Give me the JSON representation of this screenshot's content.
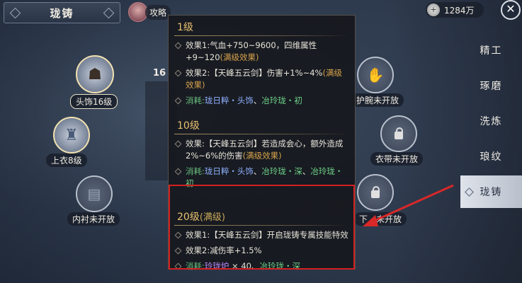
{
  "header": {
    "title": "珑铸",
    "guide_label": "攻略"
  },
  "currency": {
    "icon": "coin-icon",
    "amount": "1284万"
  },
  "menu": {
    "items": [
      {
        "label": "精工",
        "active": false
      },
      {
        "label": "琢磨",
        "active": false
      },
      {
        "label": "洗炼",
        "active": false
      },
      {
        "label": "琅纹",
        "active": false
      },
      {
        "label": "珑铸",
        "active": true
      }
    ]
  },
  "slots": {
    "headwear": "头饰16级",
    "top": "上衣8级",
    "inner": "内衬未开放",
    "wrist": "护腕未开放",
    "belt": "衣带未开放",
    "bottom_prefix": "下",
    "bottom_suffix": "未开放"
  },
  "mid": {
    "level_badge": "16"
  },
  "tooltip": {
    "levels": [
      {
        "title": "1级",
        "entries": [
          {
            "parts": [
              {
                "t": "效果1:气血+750~9600，四维属性+9~120",
                "c": "white"
              },
              {
                "t": "(满级效果)",
                "c": "gold"
              }
            ]
          },
          {
            "parts": [
              {
                "t": "效果2:【天峰五云剑】伤害+1%~4%",
                "c": "white"
              },
              {
                "t": "(满级效果)",
                "c": "gold"
              }
            ]
          },
          {
            "parts": [
              {
                "t": "消耗:",
                "c": "label-g"
              },
              {
                "t": "珑日粹・头饰",
                "c": "blue"
              },
              {
                "t": "、",
                "c": "white"
              },
              {
                "t": "冶玲珑・初",
                "c": "green"
              }
            ]
          }
        ]
      },
      {
        "title": "10级",
        "entries": [
          {
            "parts": [
              {
                "t": "效果:【天峰五云剑】若造成会心，额外造成2%~6%的伤害",
                "c": "white"
              },
              {
                "t": "(满级效果)",
                "c": "gold"
              }
            ]
          },
          {
            "parts": [
              {
                "t": "消耗:",
                "c": "label-g"
              },
              {
                "t": "珑日粹・头饰",
                "c": "blue"
              },
              {
                "t": "、",
                "c": "white"
              },
              {
                "t": "冶玲珑・深",
                "c": "green"
              },
              {
                "t": "、",
                "c": "white"
              },
              {
                "t": "冶玲珑・初",
                "c": "green"
              }
            ]
          }
        ]
      },
      {
        "title": "20级",
        "title_suffix": "(满级)",
        "entries": [
          {
            "parts": [
              {
                "t": "效果1:【天峰五云剑】开启珑铸专属技能特效",
                "c": "white"
              }
            ]
          },
          {
            "parts": [
              {
                "t": "效果2:减伤率+1.5%",
                "c": "white"
              }
            ]
          },
          {
            "parts": [
              {
                "t": "消耗:",
                "c": "label-g"
              },
              {
                "t": "玲珑炉",
                "c": "purple"
              },
              {
                "t": " × 40、",
                "c": "white"
              },
              {
                "t": "冶玲珑・深",
                "c": "green"
              }
            ]
          }
        ]
      }
    ]
  },
  "colors": {
    "highlight_box": "#d22020",
    "arrow": "#d82828",
    "accent_gold": "#e6c070"
  }
}
